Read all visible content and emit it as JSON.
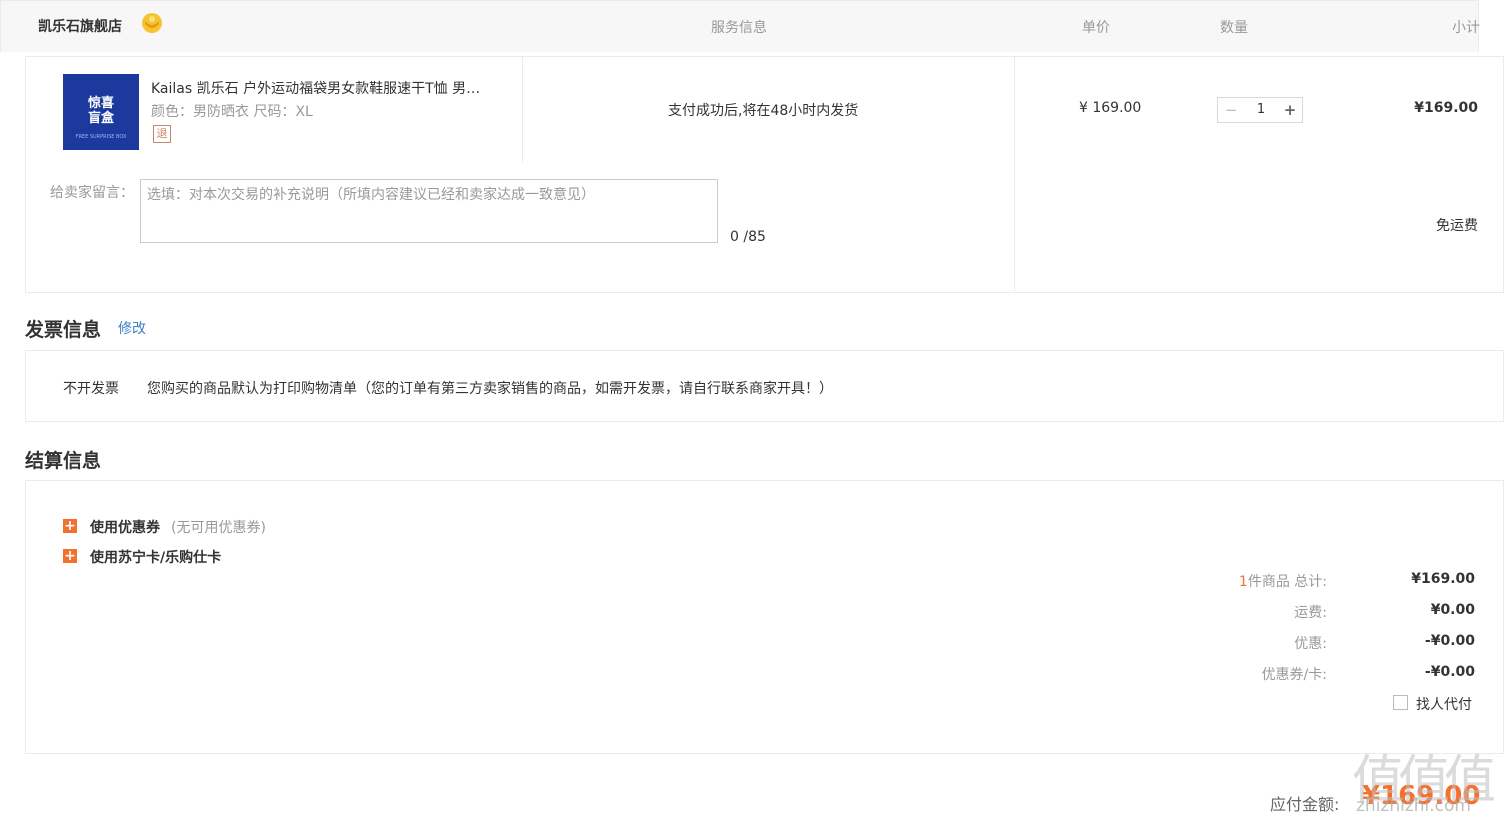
{
  "order_table": {
    "store_name": "凯乐石旗舰店",
    "store_badge_icon": "gold-crown-badge-icon",
    "headers": {
      "service": "服务信息",
      "unit_price": "单价",
      "quantity": "数量",
      "subtotal": "小计"
    },
    "item": {
      "thumb_title": "惊喜\n盲盒",
      "thumb_sub": "FREE SURPRISE BOX",
      "name": "Kailas 凯乐石 户外运动福袋男女款鞋服速干T恤 男…",
      "attrs": "颜色：男防晒衣    尺码：XL",
      "return_badge": "退",
      "shipping_note": "支付成功后,将在48小时内发货",
      "unit_price": "¥ 169.00",
      "qty_minus": "−",
      "qty": "1",
      "qty_plus": "+",
      "subtotal": "¥169.00"
    },
    "message": {
      "label": "给卖家留言：",
      "placeholder": "选填：对本次交易的补充说明（所填内容建议已经和卖家达成一致意见）",
      "value": "",
      "counter": "0 /85"
    },
    "shipping_fee_text": "免运费"
  },
  "invoice": {
    "title": "发票信息",
    "edit_link": "修改",
    "type": "不开发票",
    "note": "您购买的商品默认为打印购物清单（您的订单有第三方卖家销售的商品，如需开发票，请自行联系商家开具！）"
  },
  "settlement": {
    "title": "结算信息",
    "coupon_label": "使用优惠券",
    "coupon_note": "(无可用优惠券)",
    "card_label": "使用苏宁卡/乐购仕卡",
    "summary": {
      "count": "1",
      "count_suffix": "件商品 总计:",
      "total": "¥169.00",
      "shipping_label": "运费:",
      "shipping": "¥0.00",
      "discount_label": "优惠:",
      "discount": "-¥0.00",
      "coupon_card_label": "优惠券/卡:",
      "coupon_card": "-¥0.00"
    },
    "proxy_pay_label": "找人代付",
    "proxy_pay_checked": false
  },
  "payable": {
    "label": "应付金额:",
    "amount": "¥169.00"
  },
  "watermark": {
    "glyphs": "值值值",
    "text": "zhizhizhi.com"
  },
  "colors": {
    "accent": "#f3702f",
    "link": "#3c7ec4",
    "muted": "#999999",
    "border": "#ebebeb"
  }
}
